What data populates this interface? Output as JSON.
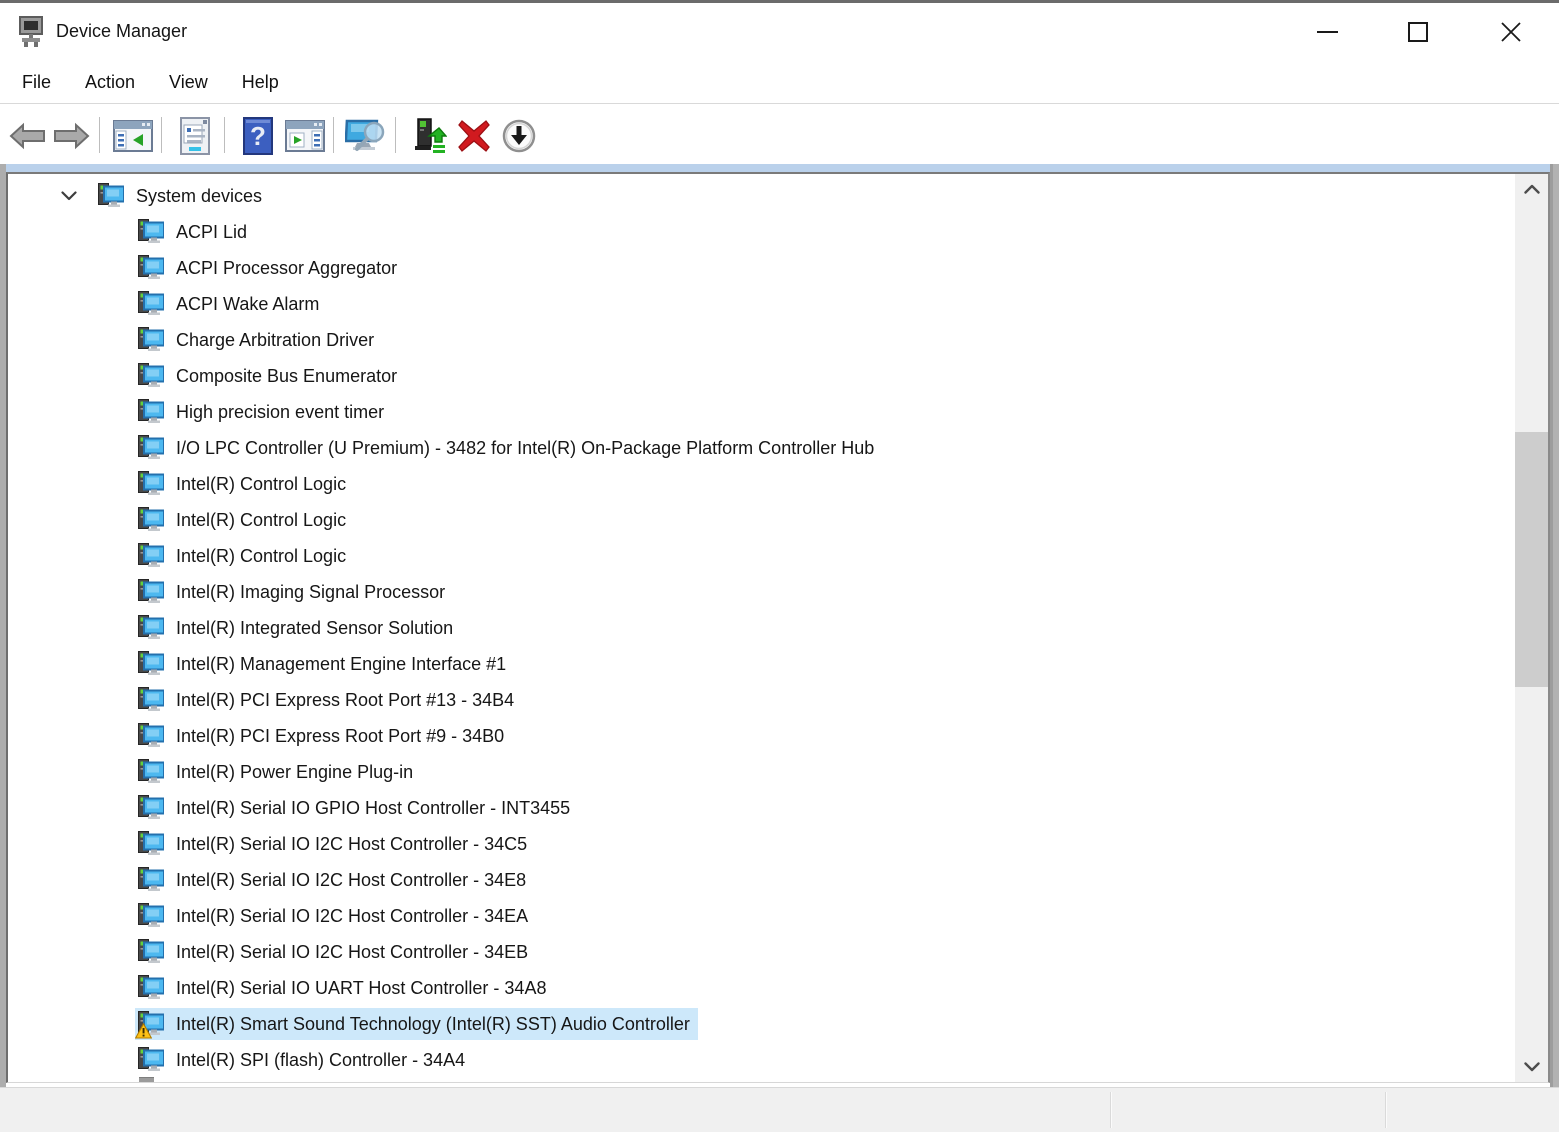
{
  "window": {
    "title": "Device Manager",
    "app_icon": "device-manager-icon",
    "controls": [
      {
        "icon": "minimize-icon"
      },
      {
        "icon": "maximize-icon"
      },
      {
        "icon": "close-icon"
      }
    ]
  },
  "menu": {
    "items": [
      "File",
      "Action",
      "View",
      "Help"
    ]
  },
  "toolbar": {
    "buttons": [
      {
        "icon": "arrow-back-icon"
      },
      {
        "icon": "arrow-forward-icon"
      },
      {
        "icon": "console-tree-icon"
      },
      {
        "icon": "properties-icon"
      },
      {
        "icon": "help-icon"
      },
      {
        "icon": "action-pane-icon"
      },
      {
        "icon": "scan-hardware-icon"
      },
      {
        "icon": "update-driver-icon"
      },
      {
        "icon": "uninstall-device-icon"
      },
      {
        "icon": "disable-device-icon"
      }
    ]
  },
  "tree": {
    "root": {
      "label": "System devices",
      "expanded": true,
      "icon": "system-device-icon",
      "chevron": "chevron-down-icon"
    },
    "children": [
      {
        "label": "ACPI Lid"
      },
      {
        "label": "ACPI Processor Aggregator"
      },
      {
        "label": "ACPI Wake Alarm"
      },
      {
        "label": "Charge Arbitration Driver"
      },
      {
        "label": "Composite Bus Enumerator"
      },
      {
        "label": "High precision event timer"
      },
      {
        "label": "I/O LPC Controller (U Premium) - 3482 for Intel(R) On-Package Platform Controller Hub"
      },
      {
        "label": "Intel(R) Control Logic"
      },
      {
        "label": "Intel(R) Control Logic"
      },
      {
        "label": "Intel(R) Control Logic"
      },
      {
        "label": "Intel(R) Imaging Signal Processor"
      },
      {
        "label": "Intel(R) Integrated Sensor Solution"
      },
      {
        "label": "Intel(R) Management Engine Interface #1"
      },
      {
        "label": "Intel(R) PCI Express Root Port #13 - 34B4"
      },
      {
        "label": "Intel(R) PCI Express Root Port #9 - 34B0"
      },
      {
        "label": "Intel(R) Power Engine Plug-in"
      },
      {
        "label": "Intel(R) Serial IO GPIO Host Controller - INT3455"
      },
      {
        "label": "Intel(R) Serial IO I2C Host Controller - 34C5"
      },
      {
        "label": "Intel(R) Serial IO I2C Host Controller - 34E8"
      },
      {
        "label": "Intel(R) Serial IO I2C Host Controller - 34EA"
      },
      {
        "label": "Intel(R) Serial IO I2C Host Controller - 34EB"
      },
      {
        "label": "Intel(R) Serial IO UART Host Controller - 34A8"
      },
      {
        "label": "Intel(R) Smart Sound Technology (Intel(R) SST) Audio Controller",
        "selected": true,
        "warning": true,
        "warning_icon": "warning-icon"
      },
      {
        "label": "Intel(R) SPI (flash) Controller - 34A4"
      }
    ]
  },
  "scrollbar": {
    "orientation": "vertical",
    "up_icon": "chevron-up-icon",
    "down_icon": "chevron-down-icon"
  },
  "colors": {
    "selection_bg": "#cde8fa",
    "accent_strip": "#bad1eb",
    "statusbar_bg": "#f0f0f0",
    "warning_yellow": "#fdc116",
    "uninstall_red": "#d11a1f",
    "update_green": "#23b223",
    "monitor_blue": "#4db8f0",
    "window_border": "#adadad"
  }
}
